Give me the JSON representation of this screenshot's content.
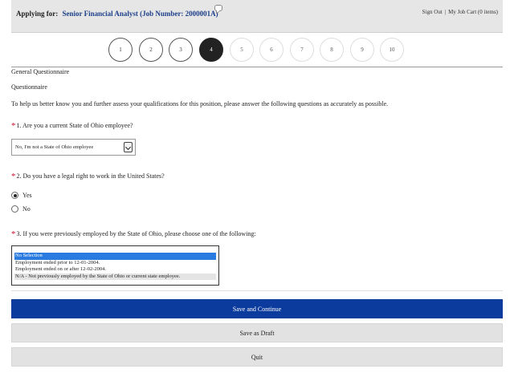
{
  "header": {
    "applying_label": "Applying for:",
    "job_title": "Senior Financial Analyst (Job Number: 2000001A)",
    "sign_out": "Sign Out",
    "separator": "|",
    "job_cart": "My Job Cart (0 items)"
  },
  "steps": {
    "items": [
      "1",
      "2",
      "3",
      "4",
      "5",
      "6",
      "7",
      "8",
      "9",
      "10"
    ],
    "active": "4"
  },
  "section": {
    "title": "General Questionnaire",
    "subtitle": "Questionnaire",
    "intro": "To help us better know you and further assess your qualifications for this position, please answer the following questions as accurately as possible."
  },
  "questions": {
    "required_mark": "*",
    "q1": {
      "text": "1. Are you a current State of Ohio employee?",
      "selected": "No, I'm not a State of Ohio employee"
    },
    "q2": {
      "text": "2. Do you have a legal right to work in the United States?",
      "options": [
        "Yes",
        "No"
      ],
      "selected": "Yes"
    },
    "q3": {
      "text": "3. If you were previously employed by the State of Ohio, please choose one of the following:",
      "options": [
        "No Selection",
        "Employment ended prior to 12-01-2004.",
        "Employment ended on or after 12-02-2004.",
        "N/A - Not previously employed by the State of Ohio or current state employee."
      ],
      "selected": "No Selection"
    }
  },
  "buttons": {
    "save_continue": "Save and Continue",
    "save_draft": "Save as Draft",
    "quit": "Quit"
  },
  "colors": {
    "primary": "#0b3b9c",
    "required": "#c8102e",
    "link": "#1d3f8a",
    "selection": "#2a7be0"
  }
}
